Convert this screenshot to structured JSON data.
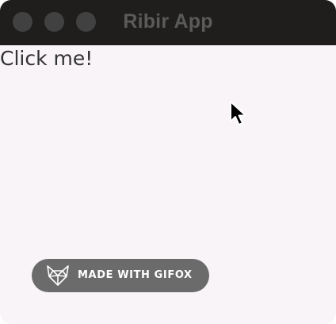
{
  "window": {
    "title": "Ribir App",
    "traffic_lights": [
      "close",
      "minimize",
      "zoom"
    ]
  },
  "content": {
    "button_label": "Click me!"
  },
  "watermark": {
    "label": "MADE WITH GIFOX",
    "icon": "fox-icon"
  },
  "colors": {
    "titlebar": "#1f1e1c",
    "title_text": "#5a5a58",
    "traffic_light": "#414141",
    "content_bg": "#f8f4f8",
    "badge_bg": "#6b6b6b"
  },
  "cursor": {
    "icon": "mouse-pointer-icon"
  }
}
